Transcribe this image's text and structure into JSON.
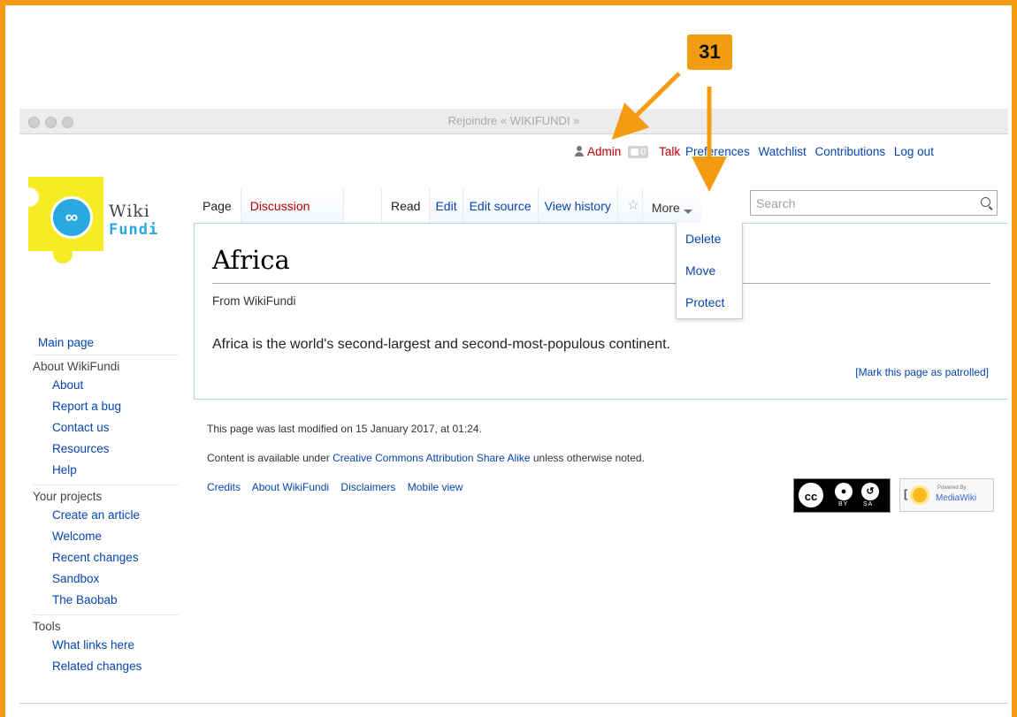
{
  "window": {
    "title": "Rejoindre « WIKIFUNDI »"
  },
  "annotation": {
    "callout_number": "31",
    "accent_color": "#f39c12"
  },
  "personal_tools": {
    "username": "Admin",
    "notifications_count": "0",
    "links": [
      "Talk",
      "Preferences",
      "Watchlist",
      "Contributions",
      "Log out"
    ]
  },
  "logo": {
    "line1": "Wiki",
    "line2": "Fundi"
  },
  "tabs": {
    "namespace": [
      "Page",
      "Discussion"
    ],
    "views": [
      "Read",
      "Edit",
      "Edit source",
      "View history"
    ],
    "more_label": "More"
  },
  "more_menu": [
    "Delete",
    "Move",
    "Protect"
  ],
  "search": {
    "placeholder": "Search"
  },
  "article": {
    "title": "Africa",
    "tagline": "From WikiFundi",
    "body": "Africa is the world's second-largest and second-most-populous continent.",
    "patrol_link": "[Mark this page as patrolled]"
  },
  "sidebar": {
    "main_page": "Main page",
    "portals": [
      {
        "heading": "About WikiFundi",
        "items": [
          "About",
          "Report a bug",
          "Contact us",
          "Resources",
          "Help"
        ]
      },
      {
        "heading": "Your projects",
        "items": [
          "Create an article",
          "Welcome",
          "Recent changes",
          "Sandbox",
          "The Baobab"
        ]
      },
      {
        "heading": "Tools",
        "items": [
          "What links here",
          "Related changes"
        ]
      }
    ]
  },
  "footer": {
    "last_modified": "This page was last modified on 15 January 2017, at 01:24.",
    "license_prefix": "Content is available under ",
    "license_link": "Creative Commons Attribution Share Alike",
    "license_suffix": " unless otherwise noted.",
    "links": [
      "Credits",
      "About WikiFundi",
      "Disclaimers",
      "Mobile view"
    ],
    "cc_badge": {
      "main": "cc",
      "by": "BY",
      "sa": "SA"
    },
    "mw_badge": {
      "powered": "Powered By",
      "name": "MediaWiki"
    }
  }
}
